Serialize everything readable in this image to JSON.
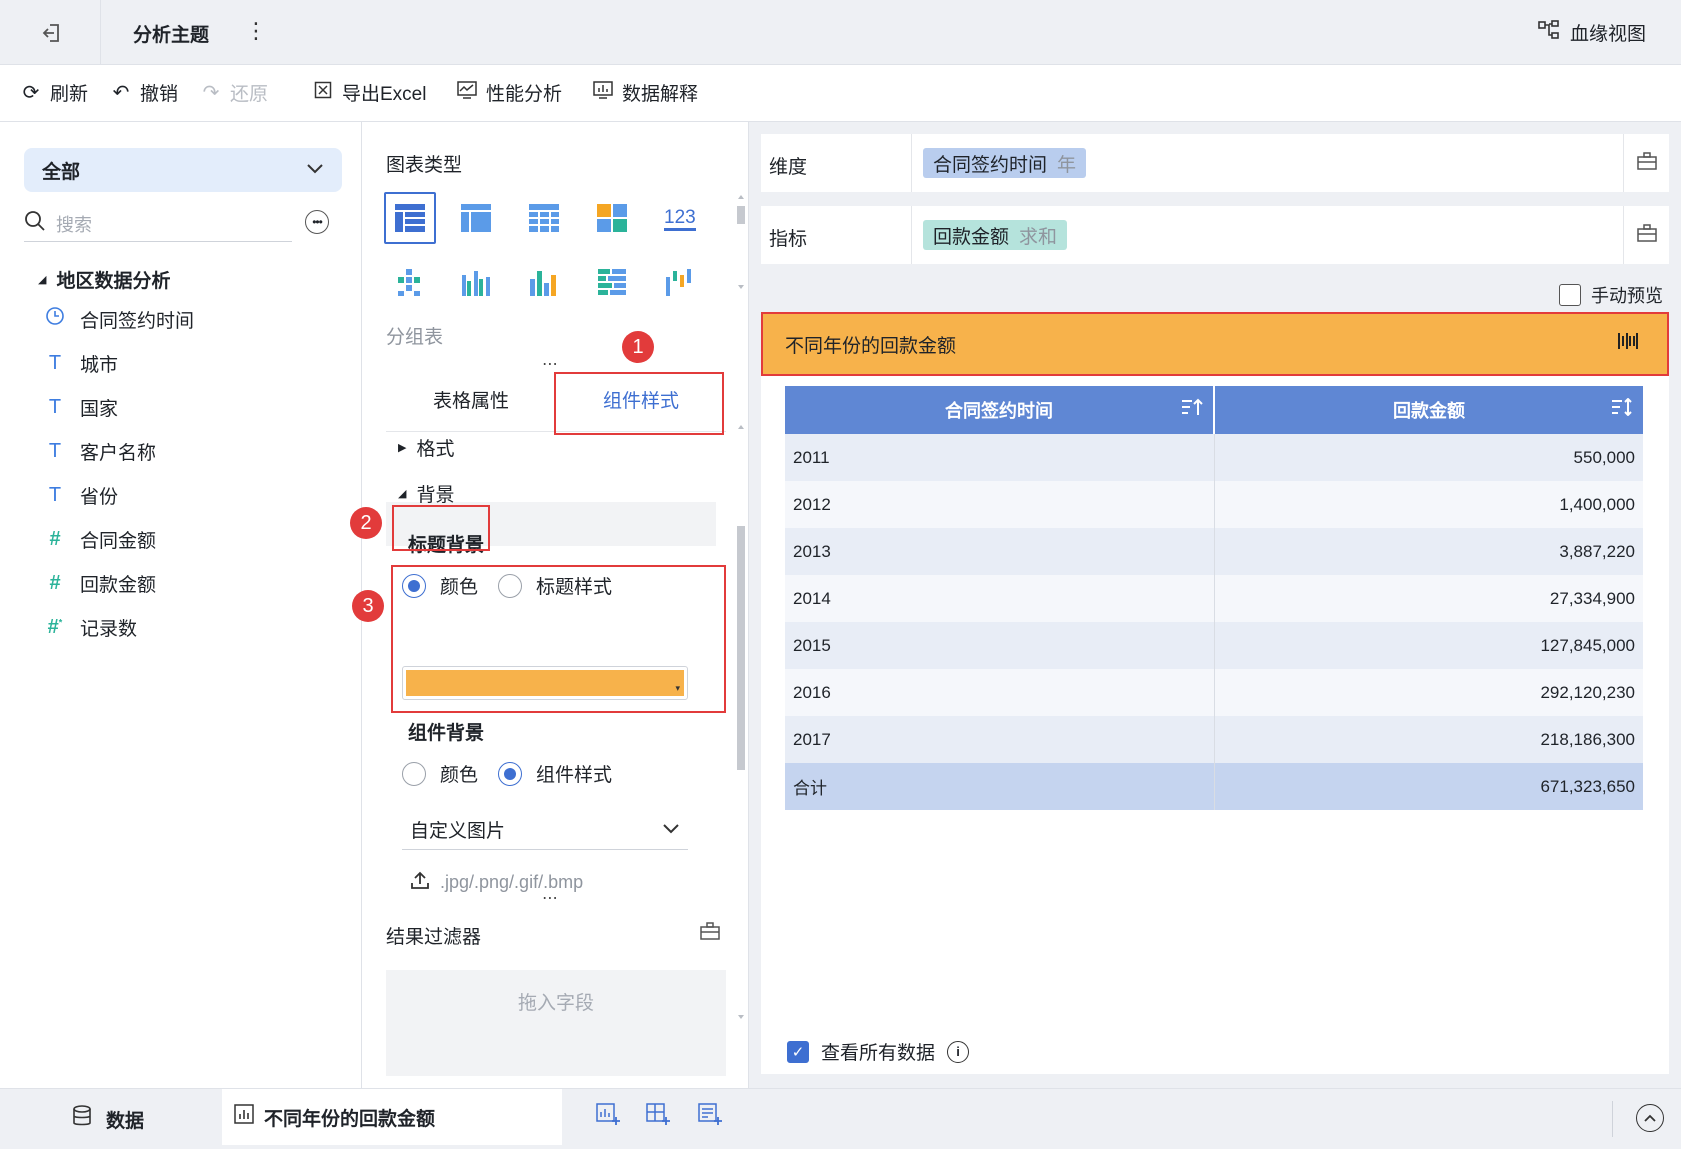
{
  "header": {
    "title": "分析主题",
    "lineage_label": "血缘视图"
  },
  "toolbar": {
    "refresh": "刷新",
    "undo": "撤销",
    "redo": "还原",
    "export_excel": "导出Excel",
    "performance": "性能分析",
    "data_explain": "数据解释"
  },
  "left": {
    "scope": "全部",
    "search_placeholder": "搜索",
    "dataset_title": "地区数据分析",
    "fields": [
      {
        "label": "合同签约时间",
        "icon": "clock-icon"
      },
      {
        "label": "城市",
        "icon": "text-type-icon"
      },
      {
        "label": "国家",
        "icon": "text-type-icon"
      },
      {
        "label": "客户名称",
        "icon": "text-type-icon"
      },
      {
        "label": "省份",
        "icon": "text-type-icon"
      },
      {
        "label": "合同金额",
        "icon": "number-type-icon"
      },
      {
        "label": "回款金额",
        "icon": "number-type-icon"
      },
      {
        "label": "记录数",
        "icon": "record-count-icon"
      }
    ]
  },
  "middle": {
    "chart_type_label": "图表类型",
    "chart_type_selected": "分组表",
    "tabs": [
      "表格属性",
      "组件样式"
    ],
    "active_tab": "组件样式",
    "sections": {
      "format": "格式",
      "background": "背景"
    },
    "title_bg": {
      "title": "标题背景",
      "option_color": "颜色",
      "option_style": "标题样式",
      "selected": "颜色",
      "color": "#f7b24b"
    },
    "component_bg": {
      "title": "组件背景",
      "option_color": "颜色",
      "option_style": "组件样式",
      "selected": "组件样式",
      "image_select": "自定义图片",
      "upload_hint": ".jpg/.png/.gif/.bmp"
    },
    "filter": {
      "title": "结果过滤器",
      "drop_hint": "拖入字段"
    }
  },
  "right": {
    "dimension": {
      "label": "维度",
      "chip": "合同签约时间",
      "agg": "年",
      "chip_color": "#b9cdee"
    },
    "measure": {
      "label": "指标",
      "chip": "回款金额",
      "agg": "求和",
      "chip_color": "#b5e3dc"
    },
    "manual_preview": "手动预览",
    "chart_title": "不同年份的回款金额",
    "table": {
      "headers": [
        "合同签约时间",
        "回款金额"
      ],
      "rows": [
        [
          "2011",
          "550,000"
        ],
        [
          "2012",
          "1,400,000"
        ],
        [
          "2013",
          "3,887,220"
        ],
        [
          "2014",
          "27,334,900"
        ],
        [
          "2015",
          "127,845,000"
        ],
        [
          "2016",
          "292,120,230"
        ],
        [
          "2017",
          "218,186,300"
        ]
      ],
      "total": [
        "合计",
        "671,323,650"
      ]
    },
    "view_all": "查看所有数据"
  },
  "annotations": [
    "1",
    "2",
    "3"
  ],
  "bottom": {
    "data_tab": "数据",
    "sheet_tab": "不同年份的回款金额"
  },
  "colors": {
    "accent": "#3e6fd1",
    "title_bg": "#f7b24b",
    "highlight": "#e23b3b",
    "table_header": "#5f87d4"
  }
}
